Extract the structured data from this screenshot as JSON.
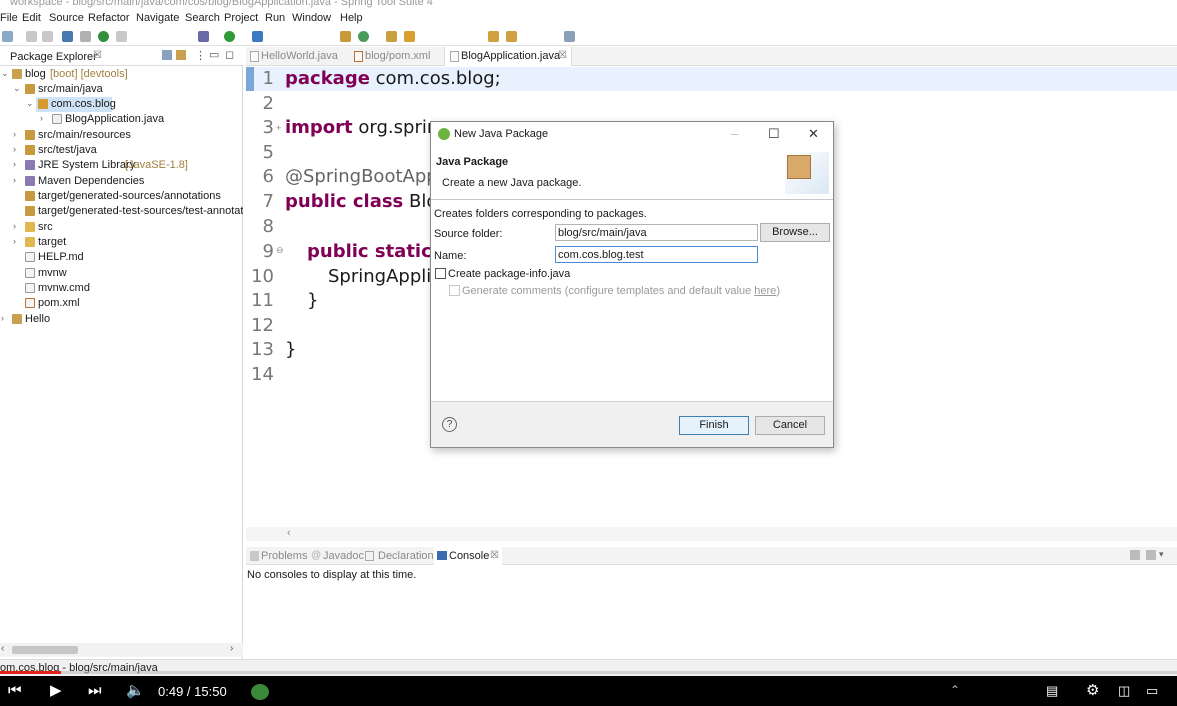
{
  "window": {
    "title": "workspace - blog/src/main/java/com/cos/blog/BlogApplication.java - Spring Tool Suite 4"
  },
  "menu": [
    "File",
    "Edit",
    "Source",
    "Refactor",
    "Navigate",
    "Search",
    "Project",
    "Run",
    "Window",
    "Help"
  ],
  "package_explorer": {
    "tab_label": "Package Explorer",
    "tree": [
      {
        "label": "blog",
        "decoration": "[boot] [devtools]"
      },
      {
        "label": "src/main/java",
        "decoration": ""
      },
      {
        "label": "com.cos.blog",
        "decoration": ""
      },
      {
        "label": "BlogApplication.java",
        "decoration": ""
      },
      {
        "label": "src/main/resources",
        "decoration": ""
      },
      {
        "label": "src/test/java",
        "decoration": ""
      },
      {
        "label": "JRE System Library",
        "decoration": "[JavaSE-1.8]"
      },
      {
        "label": "Maven Dependencies",
        "decoration": ""
      },
      {
        "label": "target/generated-sources/annotations",
        "decoration": ""
      },
      {
        "label": "target/generated-test-sources/test-annotatio",
        "decoration": ""
      },
      {
        "label": "src",
        "decoration": ""
      },
      {
        "label": "target",
        "decoration": ""
      },
      {
        "label": "HELP.md",
        "decoration": ""
      },
      {
        "label": "mvnw",
        "decoration": ""
      },
      {
        "label": "mvnw.cmd",
        "decoration": ""
      },
      {
        "label": "pom.xml",
        "decoration": ""
      },
      {
        "label": "Hello",
        "decoration": ""
      }
    ]
  },
  "editor": {
    "tabs": [
      {
        "label": "HelloWorld.java",
        "active": false
      },
      {
        "label": "blog/pom.xml",
        "active": false
      },
      {
        "label": "BlogApplication.java",
        "active": true
      }
    ],
    "lines": [
      {
        "num": "1",
        "kw": "package",
        "rest": " com.cos.blog;"
      },
      {
        "num": "2",
        "kw": "",
        "rest": ""
      },
      {
        "num": "3",
        "kw": "import",
        "rest": " org.sprin"
      },
      {
        "num": "5",
        "kw": "",
        "rest": ""
      },
      {
        "num": "6",
        "kw": "",
        "rest": "@SpringBootApp"
      },
      {
        "num": "7",
        "kw": "public class",
        "rest": " Blog"
      },
      {
        "num": "8",
        "kw": "",
        "rest": ""
      },
      {
        "num": "9",
        "kw": "public static v",
        "rest": ""
      },
      {
        "num": "10",
        "kw": "",
        "rest": "SpringApplic"
      },
      {
        "num": "11",
        "kw": "",
        "rest": "}"
      },
      {
        "num": "12",
        "kw": "",
        "rest": ""
      },
      {
        "num": "13",
        "kw": "",
        "rest": "}"
      },
      {
        "num": "14",
        "kw": "",
        "rest": ""
      }
    ]
  },
  "console": {
    "tabs": [
      "Problems",
      "Javadoc",
      "Declaration",
      "Console"
    ],
    "message": "No consoles to display at this time."
  },
  "statusbar": {
    "text": "om.cos.blog - blog/src/main/java"
  },
  "video": {
    "time": "0:49 / 15:50",
    "progress_fraction": 0.052
  },
  "dialog": {
    "title": "New Java Package",
    "heading": "Java Package",
    "subheading": "Create a new Java package.",
    "description": "Creates folders corresponding to packages.",
    "source_folder_label": "Source folder:",
    "source_folder_value": "blog/src/main/java",
    "browse_label": "Browse...",
    "name_label": "Name:",
    "name_value": "com.cos.blog.test",
    "create_info_label": "Create package-info.java",
    "generate_comments_label": "Generate comments (configure templates and default value ",
    "generate_comments_link": "here",
    "generate_comments_end": ")",
    "finish_label": "Finish",
    "cancel_label": "Cancel"
  }
}
